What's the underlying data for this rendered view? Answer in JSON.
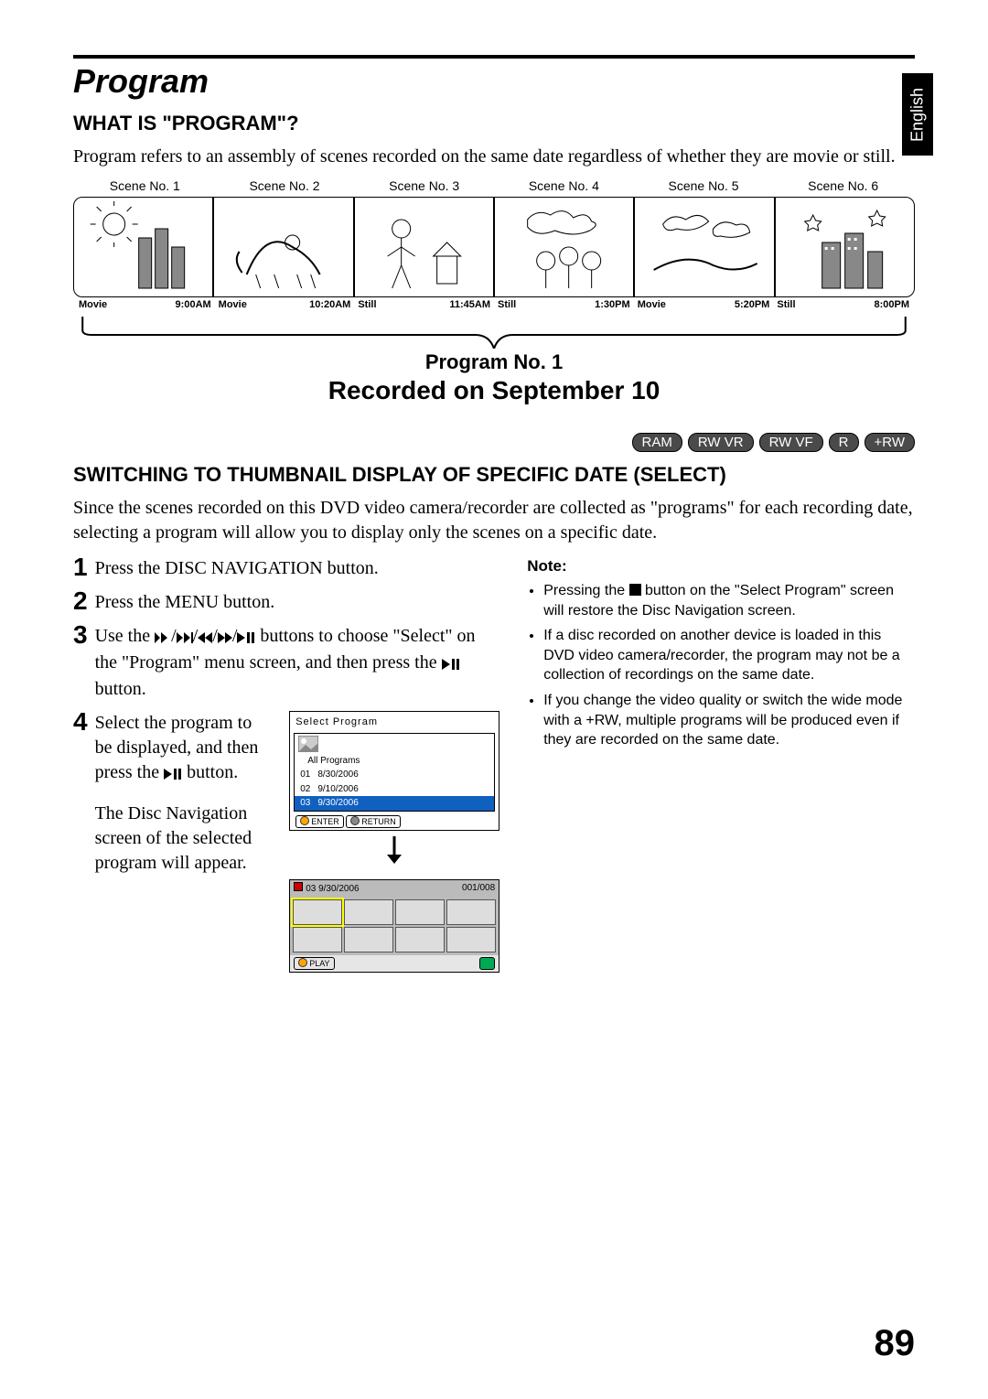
{
  "side_tab": "English",
  "page_title": "Program",
  "section1": {
    "heading": "WHAT IS \"PROGRAM\"?",
    "body": "Program refers to an assembly of scenes recorded on the same date regardless of whether they are movie or still."
  },
  "scenes": {
    "labels": [
      "Scene No. 1",
      "Scene No. 2",
      "Scene No. 3",
      "Scene No. 4",
      "Scene No. 5",
      "Scene No. 6"
    ],
    "types": [
      "Movie",
      "Movie",
      "Still",
      "Still",
      "Movie",
      "Still"
    ],
    "times": [
      "9:00AM",
      "10:20AM",
      "11:45AM",
      "1:30PM",
      "5:20PM",
      "8:00PM"
    ],
    "program_caption": "Program No. 1",
    "recorded_on": "Recorded on September 10"
  },
  "badges": [
    "RAM",
    "RW VR",
    "RW VF",
    "R",
    "+RW"
  ],
  "section2": {
    "heading": "SWITCHING TO THUMBNAIL DISPLAY OF SPECIFIC DATE (SELECT)",
    "intro": "Since the scenes recorded on this DVD video camera/recorder are collected as \"programs\" for each recording date, selecting a program will allow you to display only the scenes on a specific date.",
    "steps": {
      "s1": "Press the DISC NAVIGATION button.",
      "s2": "Press the MENU button.",
      "s3_a": "Use the ",
      "s3_b": " buttons to choose \"Select\" on the \"Program\" menu screen, and then press the ",
      "s3_c": " button.",
      "s4_a": "Select the program to be displayed, and then press the ",
      "s4_b": " button.",
      "s4_c": "The Disc Navigation screen of the selected program will appear."
    },
    "note_title": "Note:",
    "notes": {
      "n1_a": "Pressing the ",
      "n1_b": " button on the \"Select Program\" screen will restore the Disc Navigation screen.",
      "n2": "If a disc recorded on another device is loaded in this DVD video camera/recorder, the program may not be a collection of recordings on the same date.",
      "n3": "If you change the video quality or switch the wide mode with a +RW, multiple programs will be produced even if they are recorded on the same date."
    }
  },
  "shot_select": {
    "title": "Select Program",
    "all": "All Programs",
    "rows": [
      {
        "num": "01",
        "date": "8/30/2006"
      },
      {
        "num": "02",
        "date": "9/10/2006"
      },
      {
        "num": "03",
        "date": "9/30/2006"
      }
    ],
    "foot_enter": "ENTER",
    "foot_return": "RETURN"
  },
  "shot_nav": {
    "head_left": "03   9/30/2006",
    "head_right": "001/008",
    "foot_play": "PLAY"
  },
  "page_number": "89"
}
